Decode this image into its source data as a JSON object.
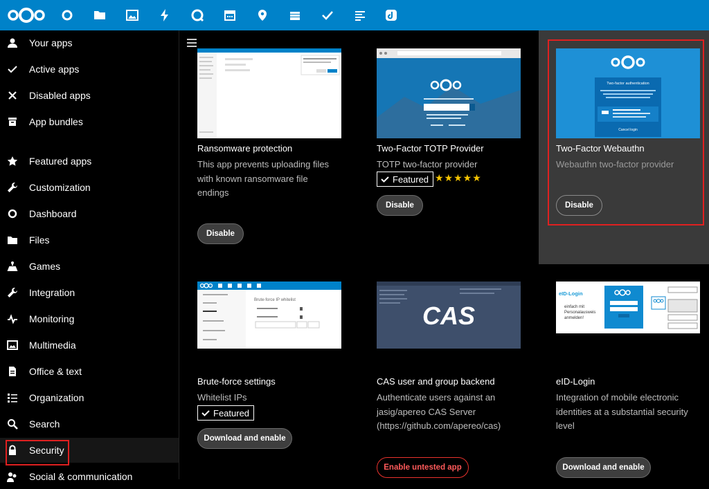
{
  "topbar": {
    "icons": [
      "nextcloud-logo",
      "dashboard-icon",
      "files-icon",
      "photos-icon",
      "activity-icon",
      "talk-icon",
      "calendar-icon",
      "maps-icon",
      "deck-icon",
      "tasks-icon",
      "notes-icon",
      "app-icon"
    ]
  },
  "sidebar": {
    "items": [
      {
        "label": "Your apps",
        "icon": "user-icon"
      },
      {
        "label": "Active apps",
        "icon": "check-icon"
      },
      {
        "label": "Disabled apps",
        "icon": "close-icon"
      },
      {
        "label": "App bundles",
        "icon": "archive-icon"
      },
      {
        "label": "Featured apps",
        "icon": "star-icon"
      },
      {
        "label": "Customization",
        "icon": "wrench-icon"
      },
      {
        "label": "Dashboard",
        "icon": "circle-icon"
      },
      {
        "label": "Files",
        "icon": "folder-icon"
      },
      {
        "label": "Games",
        "icon": "games-icon"
      },
      {
        "label": "Integration",
        "icon": "integration-icon"
      },
      {
        "label": "Monitoring",
        "icon": "monitoring-icon"
      },
      {
        "label": "Multimedia",
        "icon": "image-icon"
      },
      {
        "label": "Office & text",
        "icon": "document-icon"
      },
      {
        "label": "Organization",
        "icon": "list-icon"
      },
      {
        "label": "Search",
        "icon": "search-icon"
      },
      {
        "label": "Security",
        "icon": "lock-icon"
      },
      {
        "label": "Social & communication",
        "icon": "social-icon"
      }
    ]
  },
  "apps": [
    {
      "name": "Ransomware protection",
      "desc": "This app prevents uploading files with known ransomware file endings",
      "button": "Disable",
      "featured": false
    },
    {
      "name": "Two-Factor TOTP Provider",
      "desc": "TOTP two-factor provider",
      "button": "Disable",
      "featured": true,
      "featured_label": "Featured",
      "stars": "★★★★★"
    },
    {
      "name": "Two-Factor Webauthn",
      "desc": "Webauthn two-factor provider",
      "button": "Disable",
      "featured": false,
      "selected": true
    },
    {
      "name": "Brute-force settings",
      "desc": "Whitelist IPs",
      "button": "Download and enable",
      "featured": true,
      "featured_label": "Featured"
    },
    {
      "name": "CAS user and group backend",
      "desc": "Authenticate users against an jasig/apereo CAS Server (https://github.com/apereo/cas)",
      "button": "Enable untested app",
      "featured": false
    },
    {
      "name": "eID-Login",
      "desc": "Integration of mobile electronic identities at a substantial security level",
      "button": "Download and enable",
      "featured": false
    }
  ],
  "thumbs": {
    "cas_text": "CAS",
    "webauthn_title": "Two-factor authentication",
    "webauthn_btn": "Cancel login",
    "eid_text": "eID-Login",
    "eid_sub": "einfach mit Personalausweis anmelden!",
    "brute_title": "Brute-force IP whitelist"
  }
}
